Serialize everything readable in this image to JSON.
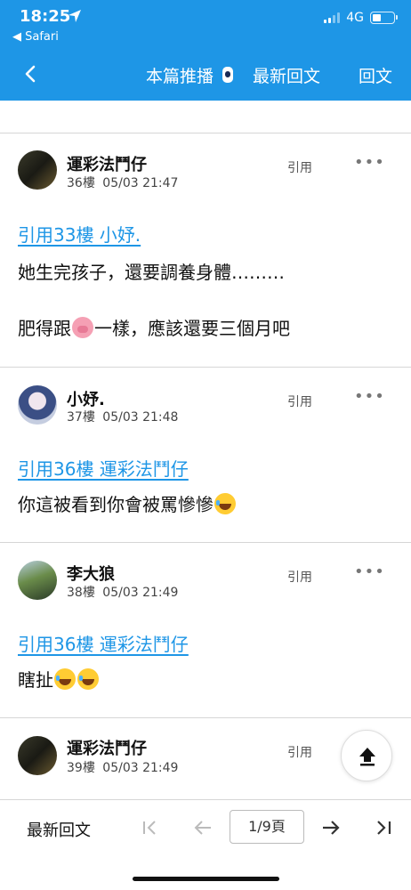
{
  "status_bar": {
    "time": "18:25",
    "back_app": "◀ Safari",
    "network": "4G"
  },
  "nav": {
    "broadcast": "本篇推播",
    "latest": "最新回文",
    "reply": "回文"
  },
  "posts": [
    {
      "username": "運彩法鬥仔",
      "floor": "36樓",
      "datetime": "05/03 21:47",
      "quote_label": "引用",
      "more": "•••",
      "quote_link": "引用33樓 小妤.",
      "lines": [
        "她生完孩子，還要調養身體………",
        "肥得跟",
        "一樣，應該還要三個月吧"
      ]
    },
    {
      "username": "小妤.",
      "floor": "37樓",
      "datetime": "05/03 21:48",
      "quote_label": "引用",
      "more": "•••",
      "quote_link": "引用36樓 運彩法鬥仔",
      "lines": [
        "你這被看到你會被罵慘慘"
      ]
    },
    {
      "username": "李大狼",
      "floor": "38樓",
      "datetime": "05/03 21:49",
      "quote_label": "引用",
      "more": "•••",
      "quote_link": "引用36樓 運彩法鬥仔",
      "lines": [
        "瞎扯"
      ]
    },
    {
      "username": "運彩法鬥仔",
      "floor": "39樓",
      "datetime": "05/03 21:49",
      "quote_label": "引用"
    }
  ],
  "bottom_bar": {
    "latest": "最新回文",
    "page_indicator": "1/9頁"
  },
  "colors": {
    "accent": "#1e96e6",
    "link": "#1e96e6",
    "divider": "#d6d6d6"
  },
  "icons": [
    "location-arrow-icon",
    "signal-icon",
    "battery-icon",
    "back-chevron-icon",
    "broadcast-icon",
    "more-dots-icon",
    "scroll-top-icon",
    "first-page-icon",
    "prev-page-icon",
    "next-page-icon",
    "last-page-icon"
  ]
}
